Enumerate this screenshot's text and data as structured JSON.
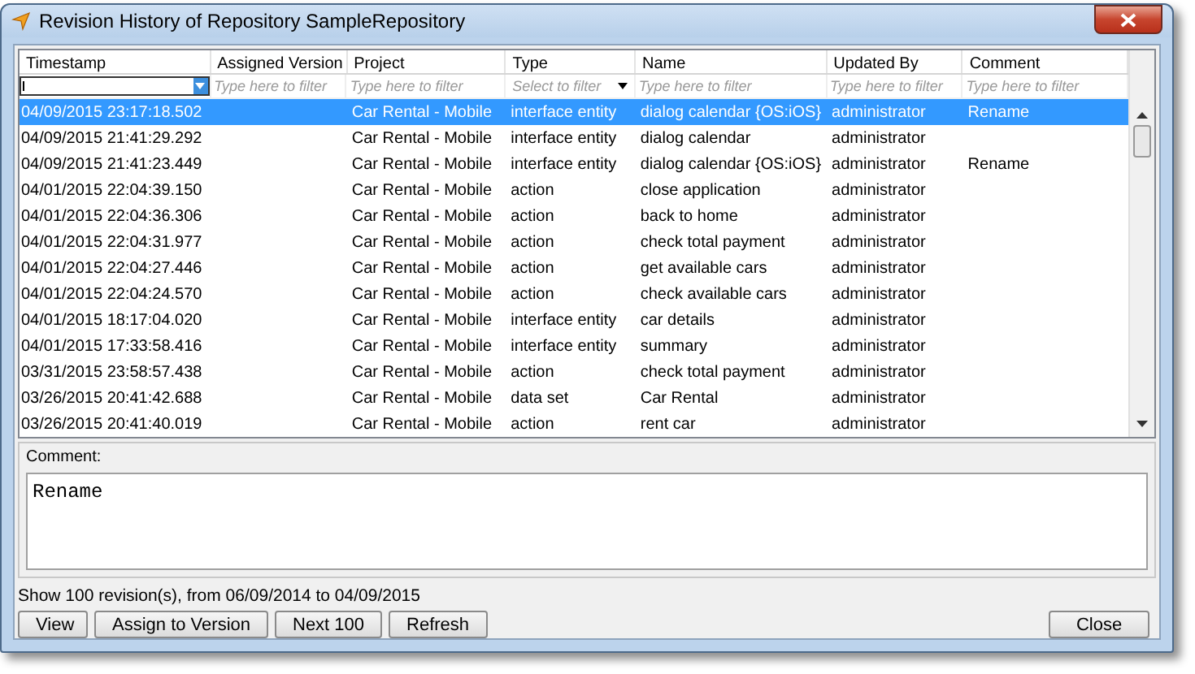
{
  "window": {
    "title": "Revision History of Repository SampleRepository"
  },
  "table": {
    "columns": [
      "Timestamp",
      "Assigned Version",
      "Project",
      "Type",
      "Name",
      "Updated By",
      "Comment"
    ],
    "filters": [
      {
        "kind": "combo"
      },
      {
        "kind": "text",
        "placeholder": "Type here to filter"
      },
      {
        "kind": "text",
        "placeholder": "Type here to filter"
      },
      {
        "kind": "select",
        "placeholder": "Select to filter"
      },
      {
        "kind": "text",
        "placeholder": "Type here to filter"
      },
      {
        "kind": "text",
        "placeholder": "Type here to filter"
      },
      {
        "kind": "text",
        "placeholder": "Type here to filter"
      }
    ],
    "rows": [
      {
        "selected": true,
        "cells": [
          "04/09/2015 23:17:18.502",
          "",
          "Car Rental - Mobile",
          "interface entity",
          "dialog calendar {OS:iOS}",
          "administrator",
          "Rename"
        ]
      },
      {
        "selected": false,
        "cells": [
          "04/09/2015 21:41:29.292",
          "",
          "Car Rental - Mobile",
          "interface entity",
          "dialog calendar",
          "administrator",
          ""
        ]
      },
      {
        "selected": false,
        "cells": [
          "04/09/2015 21:41:23.449",
          "",
          "Car Rental - Mobile",
          "interface entity",
          "dialog calendar {OS:iOS}",
          "administrator",
          "Rename"
        ]
      },
      {
        "selected": false,
        "cells": [
          "04/01/2015 22:04:39.150",
          "",
          "Car Rental - Mobile",
          "action",
          "close application",
          "administrator",
          ""
        ]
      },
      {
        "selected": false,
        "cells": [
          "04/01/2015 22:04:36.306",
          "",
          "Car Rental - Mobile",
          "action",
          "back to home",
          "administrator",
          ""
        ]
      },
      {
        "selected": false,
        "cells": [
          "04/01/2015 22:04:31.977",
          "",
          "Car Rental - Mobile",
          "action",
          "check total payment",
          "administrator",
          ""
        ]
      },
      {
        "selected": false,
        "cells": [
          "04/01/2015 22:04:27.446",
          "",
          "Car Rental - Mobile",
          "action",
          "get available cars",
          "administrator",
          ""
        ]
      },
      {
        "selected": false,
        "cells": [
          "04/01/2015 22:04:24.570",
          "",
          "Car Rental - Mobile",
          "action",
          "check available cars",
          "administrator",
          ""
        ]
      },
      {
        "selected": false,
        "cells": [
          "04/01/2015 18:17:04.020",
          "",
          "Car Rental - Mobile",
          "interface entity",
          "car details",
          "administrator",
          ""
        ]
      },
      {
        "selected": false,
        "cells": [
          "04/01/2015 17:33:58.416",
          "",
          "Car Rental - Mobile",
          "interface entity",
          "summary",
          "administrator",
          ""
        ]
      },
      {
        "selected": false,
        "cells": [
          "03/31/2015 23:58:57.438",
          "",
          "Car Rental - Mobile",
          "action",
          "check total payment",
          "administrator",
          ""
        ]
      },
      {
        "selected": false,
        "cells": [
          "03/26/2015 20:41:42.688",
          "",
          "Car Rental - Mobile",
          "data set",
          "Car Rental",
          "administrator",
          ""
        ]
      },
      {
        "selected": false,
        "cells": [
          "03/26/2015 20:41:40.019",
          "",
          "Car Rental - Mobile",
          "action",
          "rent car",
          "administrator",
          ""
        ]
      }
    ]
  },
  "comment": {
    "label": "Comment:",
    "value": "Rename"
  },
  "status": "Show 100 revision(s), from 06/09/2014 to 04/09/2015",
  "buttons": [
    "View",
    "Assign to Version",
    "Next 100",
    "Refresh"
  ],
  "close_button": "Close"
}
